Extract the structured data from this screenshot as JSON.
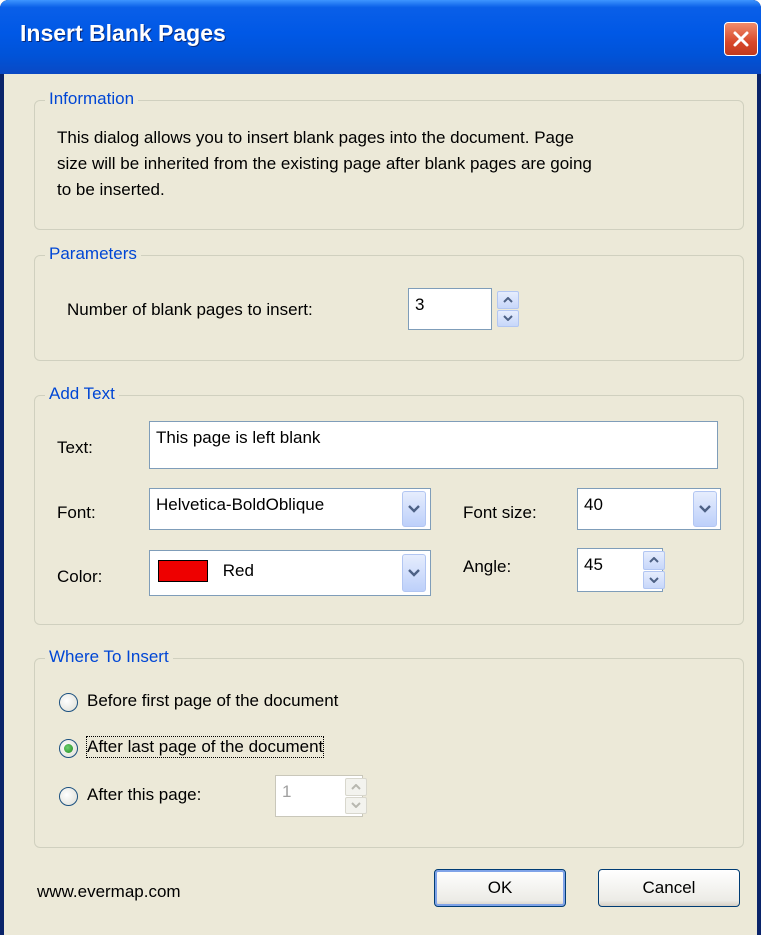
{
  "window": {
    "title": "Insert Blank Pages"
  },
  "information": {
    "legend": "Information",
    "lines": [
      "This dialog allows you to insert blank pages into the document. Page",
      "size will be inherited from the existing page after blank pages are going",
      "to be inserted."
    ]
  },
  "parameters": {
    "legend": "Parameters",
    "pages_label": "Number of blank pages to insert:",
    "pages_value": "3"
  },
  "add_text": {
    "legend": "Add Text",
    "text_label": "Text:",
    "text_value": "This page is left blank",
    "font_label": "Font:",
    "font_value": "Helvetica-BoldOblique",
    "font_size_label": "Font size:",
    "font_size_value": "40",
    "color_label": "Color:",
    "color_value": "Red",
    "color_swatch": "#ee0000",
    "angle_label": "Angle:",
    "angle_value": "45"
  },
  "where": {
    "legend": "Where To Insert",
    "options": [
      {
        "label": "Before first page of the document",
        "selected": false
      },
      {
        "label": "After last page of the document",
        "selected": true
      },
      {
        "label": "After this page:",
        "selected": false
      }
    ],
    "page_value": "1"
  },
  "footer": {
    "site": "www.evermap.com",
    "ok_label": "OK",
    "cancel_label": "Cancel"
  },
  "colors": {
    "accent": "#0046d5",
    "titlebar": "#0058e6",
    "dialog_bg": "#ece9d8",
    "close": "#d8482a"
  },
  "icons": [
    "close-icon",
    "chevron-down-icon",
    "spin-up-icon",
    "spin-down-icon",
    "radio-icon"
  ]
}
